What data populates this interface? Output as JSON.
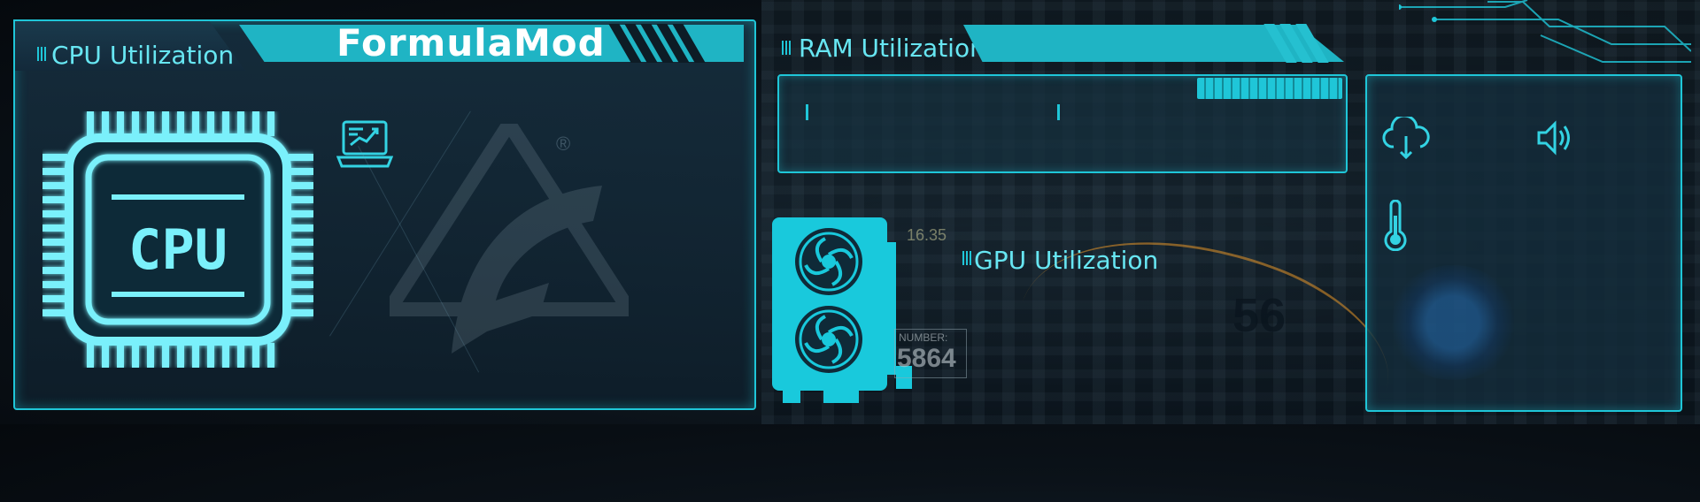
{
  "brand": {
    "name": "FormulaMod"
  },
  "cpu": {
    "title": "CPU Utilization",
    "chip_label": "CPU",
    "registered": "®"
  },
  "ram": {
    "title": "RAM Utilization"
  },
  "gpu": {
    "title": "GPU Utilization",
    "tag_label": "NUMBER:",
    "tag_number": "5864",
    "top_value": "16.35"
  },
  "ghost": {
    "value": "56"
  },
  "icons": [
    "laptop-chart-icon",
    "cloud-download-icon",
    "speaker-icon",
    "thermometer-icon",
    "globe-icon"
  ],
  "colors": {
    "accent": "#1fc6d8",
    "banner": "#1fb4c4",
    "text": "#67e6f2"
  }
}
